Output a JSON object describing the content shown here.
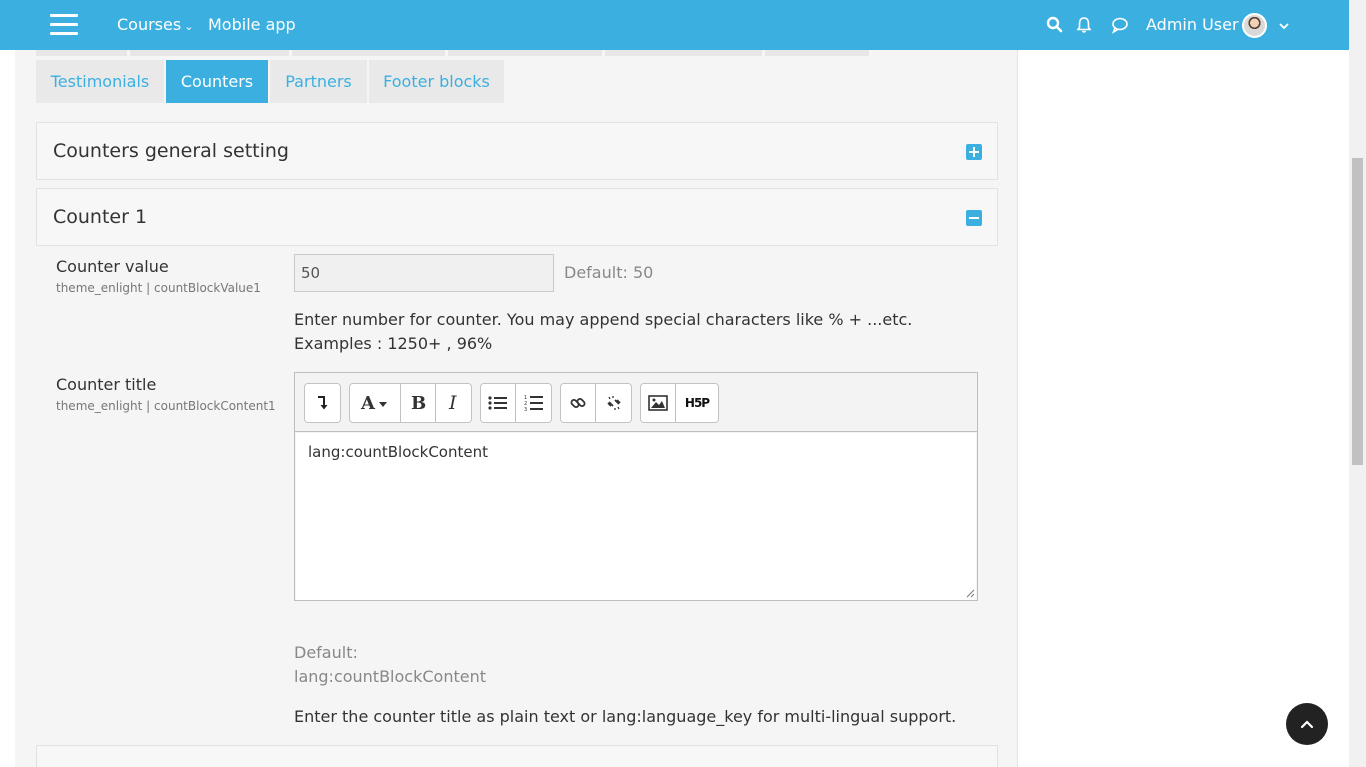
{
  "navbar": {
    "menu_icon": "hamburger-menu-icon",
    "courses_label": "Courses",
    "mobile_app_label": "Mobile app",
    "user_name": "Admin User",
    "accent_color": "#3bb0e0"
  },
  "tabs": [
    {
      "label": "Testimonials",
      "active": false
    },
    {
      "label": "Counters",
      "active": true
    },
    {
      "label": "Partners",
      "active": false
    },
    {
      "label": "Footer blocks",
      "active": false
    }
  ],
  "sections": {
    "general": {
      "title": "Counters general setting",
      "state": "collapsed"
    },
    "counter1": {
      "title": "Counter 1",
      "state": "expanded"
    }
  },
  "counter_value": {
    "label": "Counter value",
    "key": "theme_enlight | countBlockValue1",
    "value": "50",
    "default": "Default: 50",
    "description": "Enter number for counter. You may append special characters like % + ...etc. Examples : 1250+ , 96%"
  },
  "counter_title": {
    "label": "Counter title",
    "key": "theme_enlight | countBlockContent1",
    "editor_content": "lang:countBlockContent",
    "default_label": "Default:",
    "default_value": "lang:countBlockContent",
    "description": "Enter the counter title as plain text or lang:language_key for multi-lingual support."
  },
  "editor_toolbar": [
    "toggle-toolbar-icon",
    "font-style-icon",
    "bold-icon",
    "italic-icon",
    "unordered-list-icon",
    "ordered-list-icon",
    "link-icon",
    "unlink-icon",
    "image-icon",
    "h5p-icon"
  ],
  "h5p_text": "H5P"
}
